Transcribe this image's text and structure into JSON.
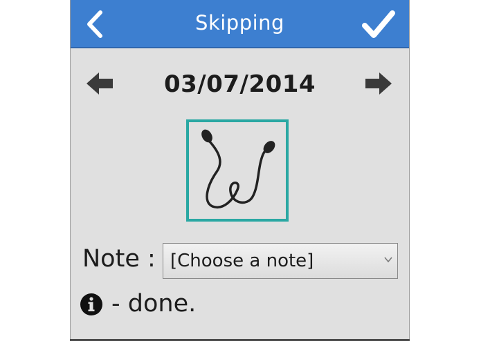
{
  "header": {
    "title": "Skipping"
  },
  "date_nav": {
    "date": "03/07/2014"
  },
  "activity": {
    "icon": "skipping-rope-icon",
    "border_color": "#2aa8a3"
  },
  "note": {
    "label": "Note :",
    "selected": "[Choose a note]"
  },
  "status": {
    "icon": "info-icon",
    "text": "- done."
  },
  "colors": {
    "header_bg": "#3d7fd0",
    "screen_bg": "#e0e0e0",
    "accent": "#2aa8a3"
  }
}
